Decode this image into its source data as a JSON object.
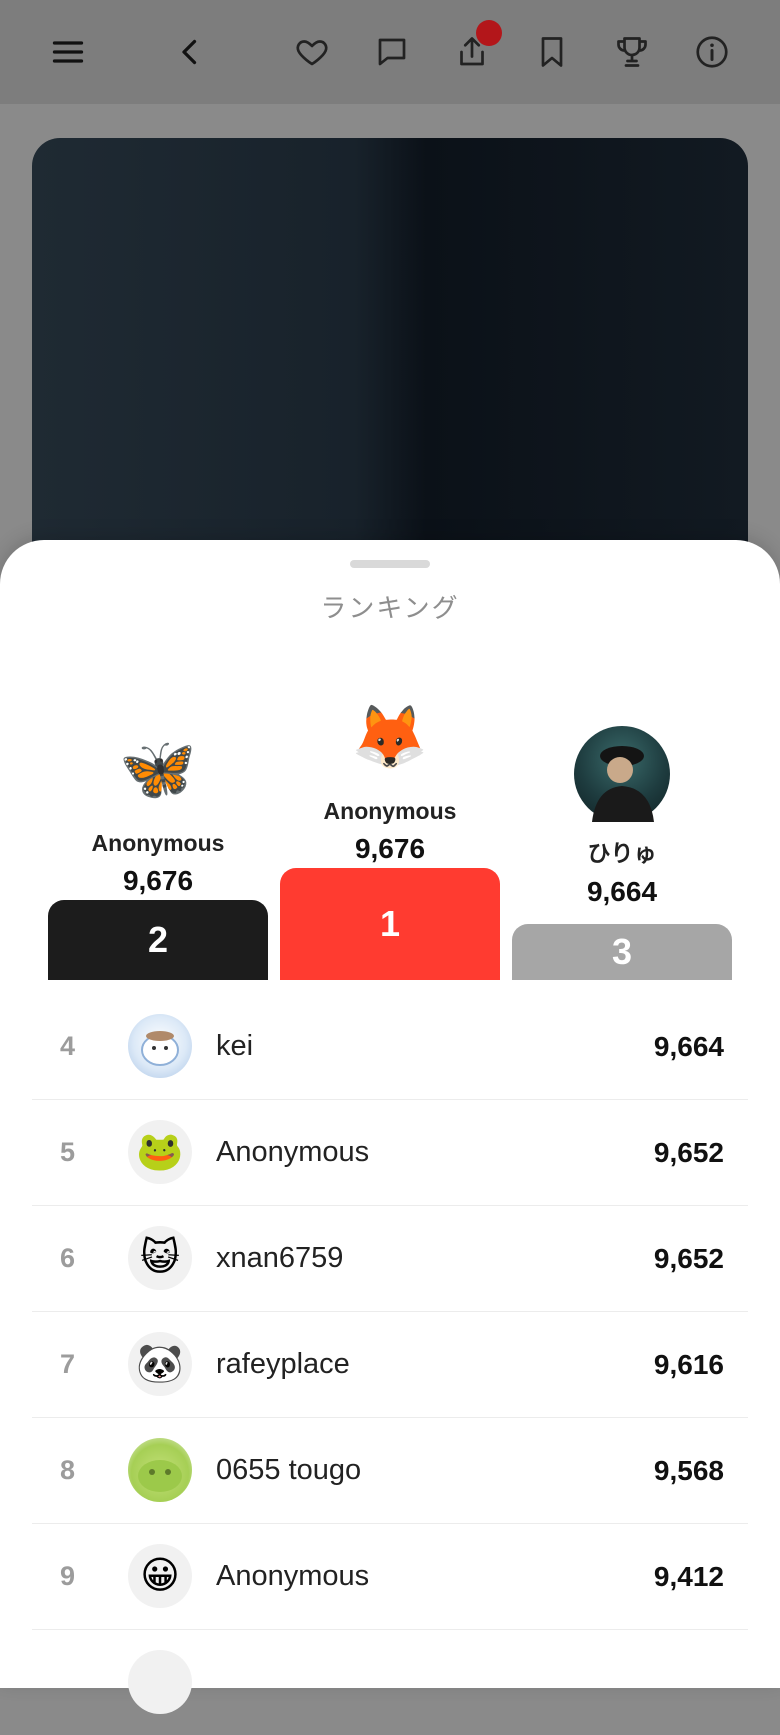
{
  "toolbar": {
    "icons": [
      "menu-icon",
      "back-chevron-icon",
      "heart-icon",
      "comment-icon",
      "share-icon",
      "bookmark-icon",
      "trophy-icon",
      "info-icon"
    ],
    "badge_color": "#b3161a"
  },
  "sheet": {
    "title": "ランキング"
  },
  "podium": [
    {
      "rank": "2",
      "name": "Anonymous",
      "score": "9,676",
      "avatar": "🦋",
      "block_color": "#1c1c1c"
    },
    {
      "rank": "1",
      "name": "Anonymous",
      "score": "9,676",
      "avatar": "🦊",
      "block_color": "#ff3b30"
    },
    {
      "rank": "3",
      "name": "ひりゅ",
      "score": "9,664",
      "avatar": "",
      "block_color": "#a6a6a6"
    }
  ],
  "leaderboard": [
    {
      "rank": "4",
      "name": "kei",
      "score": "9,664",
      "avatar": ""
    },
    {
      "rank": "5",
      "name": "Anonymous",
      "score": "9,652",
      "avatar": "🐸"
    },
    {
      "rank": "6",
      "name": "xnan6759",
      "score": "9,652",
      "avatar": "😺"
    },
    {
      "rank": "7",
      "name": "rafeyplace",
      "score": "9,616",
      "avatar": "🐼"
    },
    {
      "rank": "8",
      "name": "0655 tougo",
      "score": "9,568",
      "avatar": ""
    },
    {
      "rank": "9",
      "name": "Anonymous",
      "score": "9,412",
      "avatar": "😀"
    }
  ]
}
